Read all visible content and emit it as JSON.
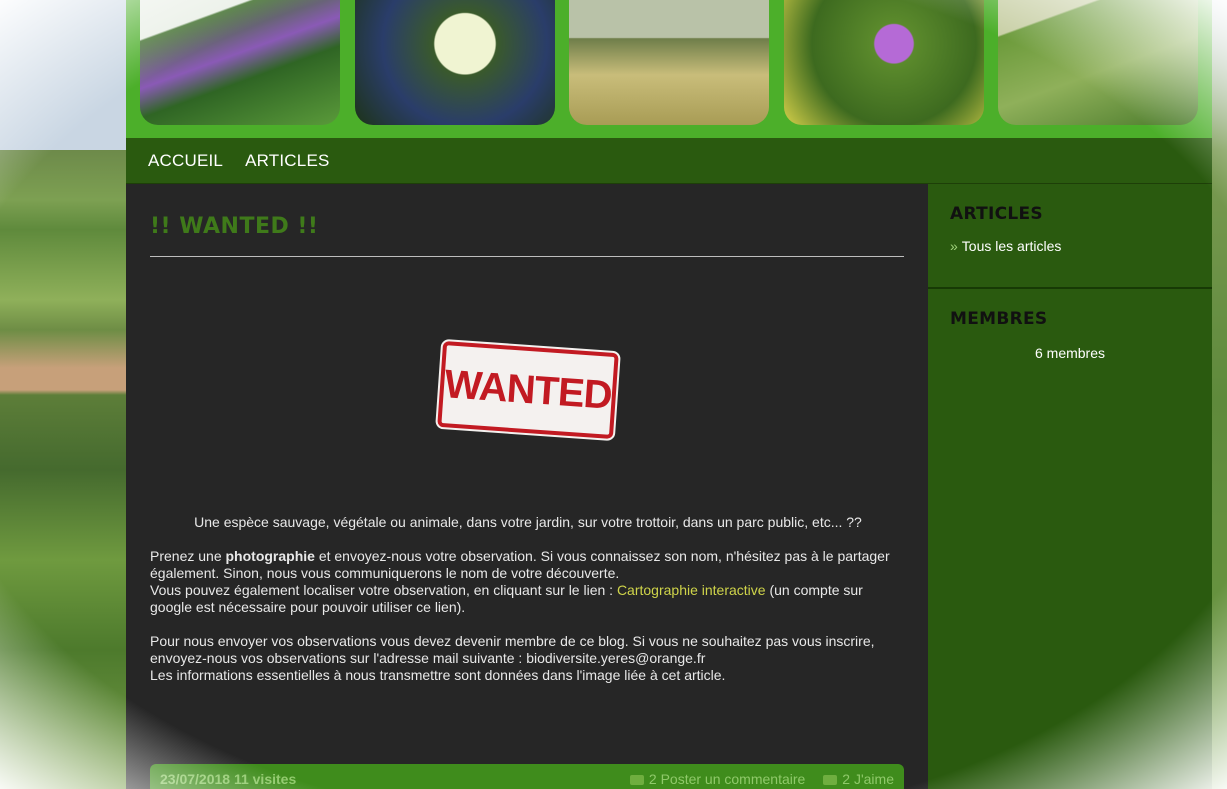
{
  "nav": {
    "items": [
      {
        "label": "ACCUEIL"
      },
      {
        "label": "ARTICLES"
      }
    ]
  },
  "post": {
    "title": "!! WANTED !!",
    "stamp_text": "WANTED",
    "intro": "Une espèce sauvage, végétale ou animale, dans votre jardin, sur votre trottoir, dans un parc public, etc... ??",
    "p2_a": "Prenez une ",
    "p2_bold": "photographie",
    "p2_b": " et envoyez-nous votre observation. Si vous connaissez son nom, n'hésitez pas à le partager également. Sinon, nous vous communiquerons le nom de votre découverte.",
    "p3_a": "Vous pouvez également localiser votre observation, en cliquant sur le lien : ",
    "p3_link": "Cartographie interactive",
    "p3_b": " (un compte sur google est nécessaire pour pouvoir utiliser ce lien).",
    "p4": "Pour nous envoyer vos observations vous devez devenir membre de ce blog. Si vous ne souhaitez pas vous inscrire, envoyez-nous vos observations sur l'adresse mail suivante : biodiversite.yeres@orange.fr",
    "p5": "Les informations essentielles à nous transmettre sont données dans l'image liée à cet article.",
    "footer": {
      "date_visits": "23/07/2018 11 visites",
      "comment": "2 Poster un commentaire",
      "likes": "2 J'aime"
    }
  },
  "sidebar": {
    "articles_title": "ARTICLES",
    "articles_link": "Tous les articles",
    "members_title": "MEMBRES",
    "members_count": "6 membres"
  },
  "colors": {
    "header_green": "#4caf2a",
    "nav_green": "#2a5a0f",
    "title_green": "#3f7a1a",
    "stamp_red": "#c21a22",
    "link_yellow": "#cfd44a"
  }
}
